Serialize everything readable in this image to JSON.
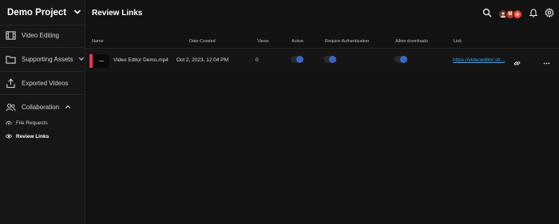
{
  "sidebar": {
    "project_name": "Demo Project",
    "items": [
      {
        "label": "Video Editing",
        "icon": "film-icon"
      },
      {
        "label": "Supporting Assets",
        "icon": "folder-icon"
      },
      {
        "label": "Exported Videos",
        "icon": "upload-icon"
      },
      {
        "label": "Collaboration",
        "icon": "people-icon"
      }
    ],
    "sub_items": [
      {
        "label": "File Requests",
        "icon": "cloud-upload-icon"
      },
      {
        "label": "Review Links",
        "icon": "eye-icon",
        "active": true
      }
    ]
  },
  "header": {
    "title": "Review Links",
    "avatars": [
      "M",
      "+"
    ]
  },
  "table": {
    "columns": [
      "Name",
      "Date Created",
      "Views",
      "Active",
      "Require Authentication",
      "Allow downloads",
      "Link"
    ],
    "rows": [
      {
        "name": "Video Editor Demo.mp4",
        "date_created": "Oct 2, 2023, 12:04 PM",
        "views": "0",
        "active": true,
        "require_authentication": true,
        "allow_downloads": true,
        "link": "https://videoeditor.str..."
      }
    ]
  },
  "colors": {
    "accent": "#3d63c7",
    "link": "#4a9fe0",
    "brand": "#e63950"
  }
}
